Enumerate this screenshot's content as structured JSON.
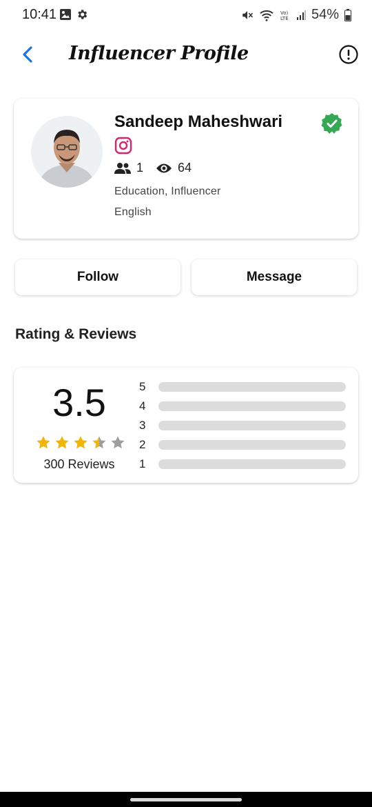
{
  "status_bar": {
    "time": "10:41",
    "battery": "54%",
    "left_icons": [
      "image-icon",
      "settings-gear-icon"
    ],
    "right_icons": [
      "mute-icon",
      "wifi-icon",
      "volte-icon",
      "signal-icon",
      "battery-icon"
    ]
  },
  "header": {
    "title": "Influencer Profile",
    "back_icon": "chevron-left-icon",
    "info_icon": "exclamation-circle-icon"
  },
  "profile": {
    "name": "Sandeep Maheshwari",
    "verified": true,
    "platform_icon": "instagram-icon",
    "followers": "1",
    "views": "64",
    "category": "Education, Influencer",
    "language": "English"
  },
  "actions": {
    "follow_label": "Follow",
    "message_label": "Message"
  },
  "ratings": {
    "section_title": "Rating & Reviews",
    "average": "3.5",
    "average_value": 3.5,
    "max_stars": 5,
    "reviews_label": "300 Reviews",
    "breakdown": [
      {
        "stars": "5",
        "fraction": 0
      },
      {
        "stars": "4",
        "fraction": 0
      },
      {
        "stars": "3",
        "fraction": 0
      },
      {
        "stars": "2",
        "fraction": 0
      },
      {
        "stars": "1",
        "fraction": 0
      }
    ]
  },
  "colors": {
    "accent_blue": "#1a73e8",
    "verified_green": "#34a853",
    "instagram_pink": "#d6246e",
    "star_gold": "#f4b400",
    "star_empty": "#9e9e9e",
    "bar_track": "#dcdcdc"
  }
}
